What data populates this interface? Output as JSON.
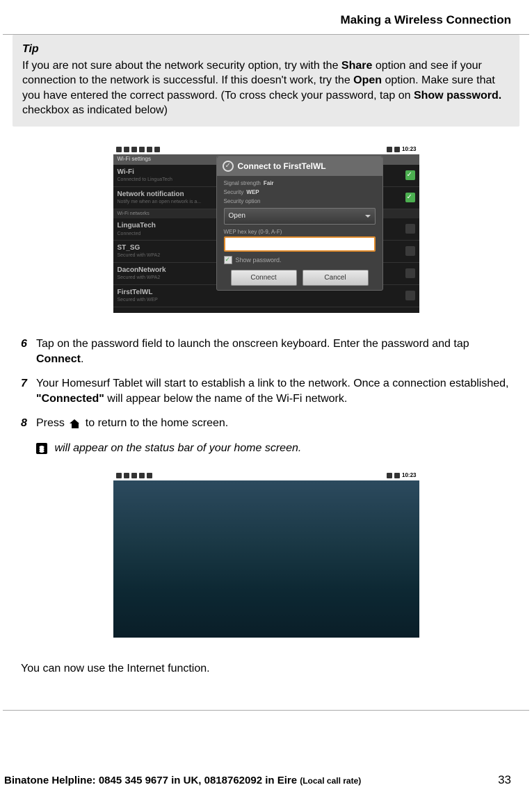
{
  "header": {
    "title": "Making a Wireless Connection"
  },
  "tip": {
    "label": "Tip",
    "text_parts": {
      "p1": "If you are not sure about the network security option, try with the ",
      "share": "Share",
      "p2": " option and see if your connection to the network is successful. If this doesn't work, try the ",
      "open": "Open",
      "p3": " option. Make sure that you have entered the correct password. (To cross check your password, tap on ",
      "showpw": "Show password.",
      "p4": " checkbox as indicated below)"
    }
  },
  "screenshot1": {
    "status_time": "10:23",
    "wifi_settings_label": "Wi-Fi settings",
    "rows": [
      {
        "name": "Wi-Fi",
        "sub": "Connected to LinguaTech",
        "check": true
      },
      {
        "name": "Network notification",
        "sub": "Notify me when an open network is a...",
        "check": true
      }
    ],
    "section_header": "Wi-Fi networks",
    "networks": [
      {
        "name": "LinguaTech",
        "sub": "Connected"
      },
      {
        "name": "ST_SG",
        "sub": "Secured with WPA2"
      },
      {
        "name": "DaconNetwork",
        "sub": "Secured with WPA2"
      },
      {
        "name": "FirstTelWL",
        "sub": "Secured with WEP"
      }
    ],
    "dialog": {
      "title": "Connect to FirstTelWL",
      "signal_label": "Signal strength",
      "signal_value": "Fair",
      "security_label": "Security",
      "security_value": "WEP",
      "secopt_label": "Security option",
      "select_value": "Open",
      "hex_label": "WEP hex key (0-9, A-F)",
      "show_password": "Show password.",
      "connect": "Connect",
      "cancel": "Cancel"
    }
  },
  "steps": {
    "s6_num": "6",
    "s6": {
      "p1": "Tap on the password field to launch the onscreen keyboard. Enter the password and tap ",
      "b1": "Connect",
      "p2": "."
    },
    "s7_num": "7",
    "s7": {
      "p1": "Your Homesurf Tablet will start to establish a link to the network. Once a connection established, ",
      "b1": "\"Connected\"",
      "p2": " will appear below the name of the Wi-Fi network."
    },
    "s8_num": "8",
    "s8": {
      "p1": "Press ",
      "p2": " to return to the home screen."
    },
    "note": " will appear on the status bar of your home screen."
  },
  "screenshot2": {
    "status_time": "10:23"
  },
  "closing": "You can now use the Internet function.",
  "footer": {
    "prefix": "Binatone Helpline: 0845 345 9677 in UK, 0818762092 in Eire ",
    "suffix": "(Local call rate)",
    "page": "33"
  }
}
